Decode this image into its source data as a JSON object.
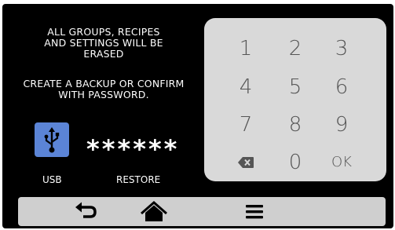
{
  "warning": {
    "line1": "ALL GROUPS, RECIPES",
    "line2": "AND SETTINGS WILL BE",
    "line3": "ERASED",
    "line4": "CREATE A BACKUP  OR CONFIRM",
    "line5": "WITH PASSWORD."
  },
  "password": {
    "masked_value": "******"
  },
  "usb": {
    "label": "USB",
    "icon": "usb-icon"
  },
  "restore": {
    "label": "RESTORE"
  },
  "keypad": {
    "keys": [
      "1",
      "2",
      "3",
      "4",
      "5",
      "6",
      "7",
      "8",
      "9",
      "",
      "0",
      "OK"
    ],
    "backspace_icon": "backspace-icon"
  },
  "nav": {
    "back_icon": "back-arrow-icon",
    "home_icon": "home-icon",
    "menu_icon": "menu-icon"
  },
  "colors": {
    "screen_bg": "#000000",
    "keypad_bg": "#d9d9d9",
    "key_text": "#555555",
    "usb_button": "#5b84d6",
    "navbar_bg": "#cfcfcf"
  }
}
